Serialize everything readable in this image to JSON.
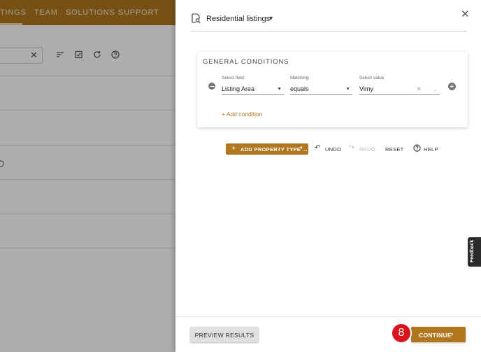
{
  "background_app": {
    "nav": [
      "TINGS",
      "TEAM",
      "SOLUTIONS",
      "SUPPORT"
    ],
    "icons": [
      "close-icon",
      "sort-icon",
      "checklist-icon",
      "refresh-icon",
      "help-icon"
    ],
    "colors": {
      "nav": "#b0771f"
    }
  },
  "drawer": {
    "title": "Residential listings",
    "title_icon": "search-document-icon",
    "close_icon": "close-icon"
  },
  "conditions": {
    "heading": "GENERAL CONDITIONS",
    "rows": [
      {
        "field_label": "Select field:",
        "field_value": "Listing Area",
        "matching_label": "Matching:",
        "matching_value": "equals",
        "value_label": "Select value",
        "value_value": "Vimy"
      }
    ],
    "add_condition": "+ Add condition"
  },
  "toolbar": {
    "add_property": "ADD PROPERTY TYPE ...",
    "undo": "UNDO",
    "redo": "REDO",
    "reset": "RESET",
    "help": "HELP"
  },
  "feedback": "Feedback",
  "footer": {
    "preview": "PREVIEW RESULTS",
    "continue": "CONTINUE",
    "step_badge": "8"
  },
  "colors": {
    "accent": "#b0771f",
    "badge": "#d9141d"
  }
}
